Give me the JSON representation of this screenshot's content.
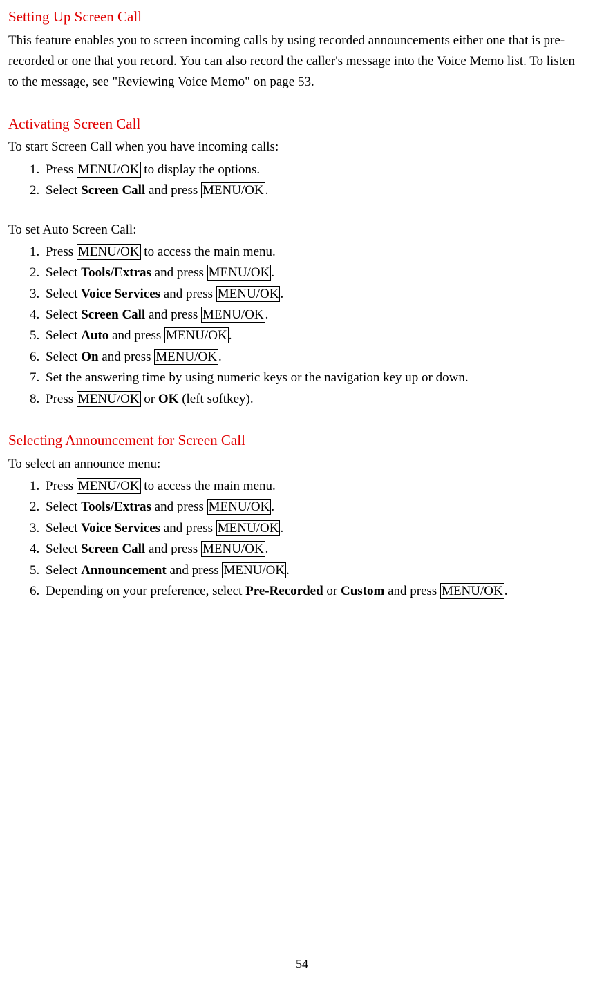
{
  "title1": "Setting Up Screen Call",
  "intro": "This feature enables you to screen incoming calls by using recorded announcements either one that is pre-recorded or one that you record. You can also record the caller's message into the Voice Memo list. To listen to the message, see \"Reviewing Voice Memo\" on page 53.",
  "title2": "Activating Screen Call",
  "activating_lead": "To start Screen Call when you have incoming calls:",
  "key_menuok": "MENU/OK",
  "steps_a": {
    "s1_a": "Press ",
    "s1_b": " to display the options.",
    "s2_a": "Select ",
    "s2_bold": "Screen Call",
    "s2_b": " and press ",
    "s2_c": "."
  },
  "auto_lead": "To set Auto Screen Call:",
  "steps_b": {
    "s1_a": "Press ",
    "s1_b": " to access the main menu.",
    "s2_a": "Select ",
    "s2_bold": "Tools/Extras",
    "s2_b": " and press ",
    "s2_c": ".",
    "s3_a": "Select ",
    "s3_bold": "Voice Services",
    "s3_b": " and press ",
    "s3_c": ".",
    "s4_a": "Select ",
    "s4_bold": "Screen Call",
    "s4_b": " and press ",
    "s4_c": ".",
    "s5_a": "Select ",
    "s5_bold": "Auto",
    "s5_b": " and press ",
    "s5_c": ".",
    "s6_a": "Select ",
    "s6_bold": "On",
    "s6_b": " and press ",
    "s6_c": ".",
    "s7": "Set the answering time by using numeric keys or the navigation key up or down.",
    "s8_a": "Press ",
    "s8_b": " or ",
    "s8_bold": "OK",
    "s8_c": " (left softkey)."
  },
  "title3": "Selecting Announcement for Screen Call",
  "selecting_lead": "To select an announce menu:",
  "steps_c": {
    "s1_a": "Press ",
    "s1_b": " to access the main menu.",
    "s2_a": "Select ",
    "s2_bold": "Tools/Extras",
    "s2_b": " and press ",
    "s2_c": ".",
    "s3_a": "Select ",
    "s3_bold": "Voice Services",
    "s3_b": " and press ",
    "s3_c": ".",
    "s4_a": "Select ",
    "s4_bold": "Screen Call",
    "s4_b": " and press ",
    "s4_c": ".",
    "s5_a": "Select ",
    "s5_bold": "Announcement",
    "s5_b": " and press ",
    "s5_c": ".",
    "s6_a": "Depending on your preference, select ",
    "s6_bold1": "Pre-Recorded",
    "s6_mid": " or ",
    "s6_bold2": "Custom",
    "s6_b": " and press ",
    "s6_c": "."
  },
  "page_number": "54"
}
